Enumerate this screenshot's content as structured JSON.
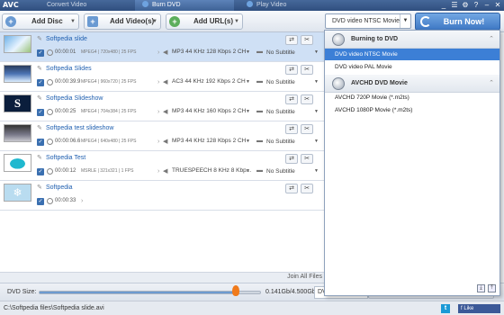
{
  "app": {
    "logo": "AVC"
  },
  "tabs": [
    {
      "label": "Convert Video"
    },
    {
      "label": "Burn DVD"
    },
    {
      "label": "Play Video"
    }
  ],
  "window_controls": [
    "_",
    "☰",
    "⚙",
    "?",
    "–",
    "✕"
  ],
  "toolbar": {
    "add_disc": "Add Disc",
    "add_videos": "Add Video(s)",
    "add_urls": "Add URL(s)"
  },
  "format_select": {
    "value": "DVD video NTSC Movie"
  },
  "burn_button": "Burn Now!",
  "files": [
    {
      "name": "Softpedia slide",
      "duration": "00:00:01",
      "video": "MPEG4 | 720x480 | 25 FPS",
      "audio": "MP3 44 KHz 128 Kbps 2 CH",
      "subtitle": "No Subtitle",
      "selected": true
    },
    {
      "name": "Softpedia Slides",
      "duration": "00:00:39.9",
      "video": "MPEG4 | 960x720 | 25 FPS",
      "audio": "AC3 44 KHz 192 Kbps 2 CH",
      "subtitle": "No Subtitle",
      "selected": false
    },
    {
      "name": "Softpedia Slideshow",
      "duration": "00:00:25",
      "video": "MPEG4 | 704x384 | 25 FPS",
      "audio": "MP3 44 KHz 160 Kbps 2 CH",
      "subtitle": "No Subtitle",
      "selected": false
    },
    {
      "name": "Softpedia test slideshow",
      "duration": "00:00:06.6",
      "video": "MPEG4 | 640x480 | 25 FPS",
      "audio": "MP3 44 KHz 128 Kbps 2 CH",
      "subtitle": "No Subtitle",
      "selected": false
    },
    {
      "name": "Softpedia Test",
      "duration": "00:00:12",
      "video": "MSRLE | 321x321 | 1 FPS",
      "audio": "TRUESPEECH 8 KHz 8 Kbp...",
      "subtitle": "No Subtitle",
      "selected": false
    },
    {
      "name": "Softpedia",
      "duration": "00:00:33",
      "video": "",
      "audio": "",
      "subtitle": "",
      "selected": false
    }
  ],
  "join_all": "Join All Files",
  "dvd_size": {
    "label": "DVD Size:",
    "value": "0.141Gb/4.500Gb",
    "fill_fraction": 0.89,
    "disc": "DVD"
  },
  "audio_options": "Audio Options",
  "status": {
    "path": "C:\\Softpedia files\\Softpedia slide.avi",
    "twitter": "t",
    "facebook": "f Like"
  },
  "dropdown": {
    "groups": [
      {
        "label": "Burning to DVD",
        "options": [
          "DVD video NTSC Movie",
          "DVD video PAL Movie"
        ],
        "selected": 0
      },
      {
        "label": "AVCHD DVD Movie",
        "options": [
          "AVCHD 720P Movie (*.m2ts)",
          "AVCHD 1080P Movie (*.m2ts)"
        ],
        "selected": -1
      }
    ]
  }
}
